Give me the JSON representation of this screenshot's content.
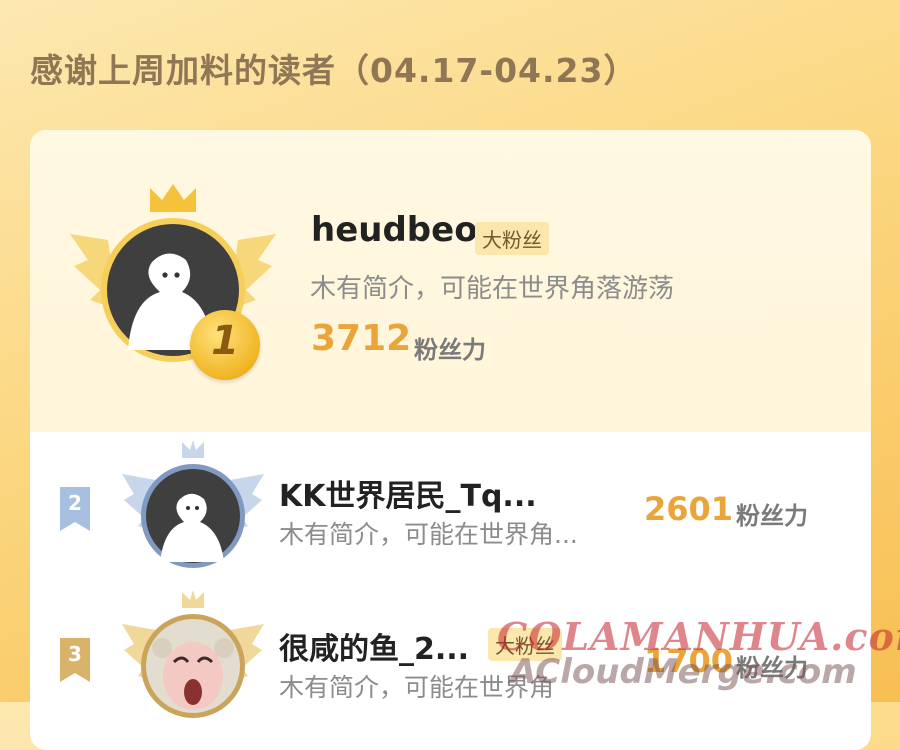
{
  "header": {
    "title": "感谢上周加料的读者（04.17-04.23）"
  },
  "score_unit": "粉丝力",
  "entries": [
    {
      "rank": "1",
      "name": "heudbeo",
      "badge": "大粉丝",
      "bio": "木有简介，可能在世界角落游荡",
      "score": "3712"
    },
    {
      "rank": "2",
      "name": "KK世界居民_Tq...",
      "bio": "木有简介，可能在世界角...",
      "score": "2601"
    },
    {
      "rank": "3",
      "name": "很咸的鱼_2...",
      "badge": "大粉丝",
      "bio": "木有简介，可能在世界角",
      "score": "1700"
    }
  ],
  "watermark": {
    "line1": "COLAMANHUA.com",
    "line2": "ACloudMerge.com"
  },
  "colors": {
    "accent": "#eaa53a",
    "gold": "#f5c33b",
    "silver": "#9fb6d6",
    "bronze": "#d9b36a"
  }
}
